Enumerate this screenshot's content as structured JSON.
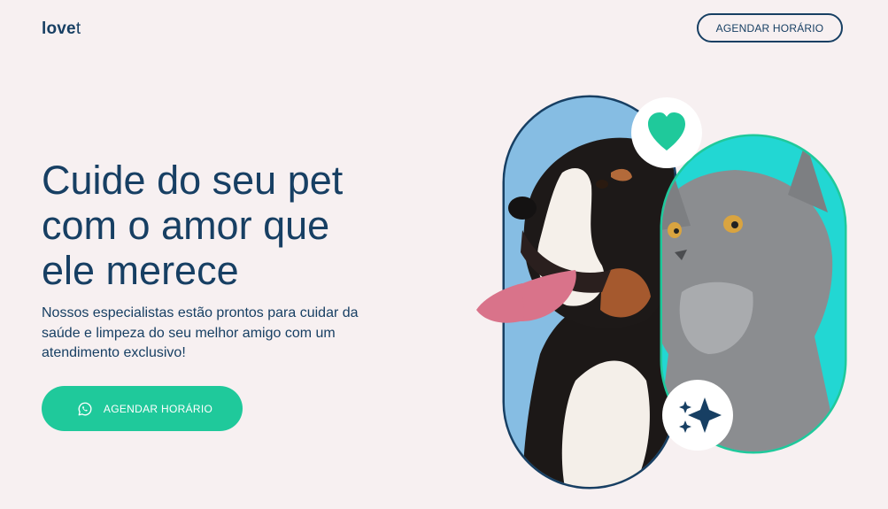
{
  "header": {
    "logo_main": "love",
    "logo_tail": "t",
    "cta_label": "AGENDAR HORÁRIO"
  },
  "hero": {
    "title_lines": [
      "Cuide do seu pet",
      "com o amor que",
      "ele merece"
    ],
    "subtitle": "Nossos especialistas estão prontos para cuidar da saúde e limpeza do seu melhor amigo com um atendimento exclusivo!",
    "cta_label": "AGENDAR HORÁRIO",
    "cta_icon": "whatsapp-icon"
  },
  "illustration": {
    "dog": "dog-photo",
    "cat": "cat-photo",
    "badge_top_icon": "heart-icon",
    "badge_bottom_icon": "sparkles-icon"
  },
  "colors": {
    "background": "#f7f0f1",
    "primary": "#173f63",
    "accent": "#1fc99b",
    "dog_backdrop": "#79b1da",
    "cat_backdrop": "#22d7d3"
  }
}
